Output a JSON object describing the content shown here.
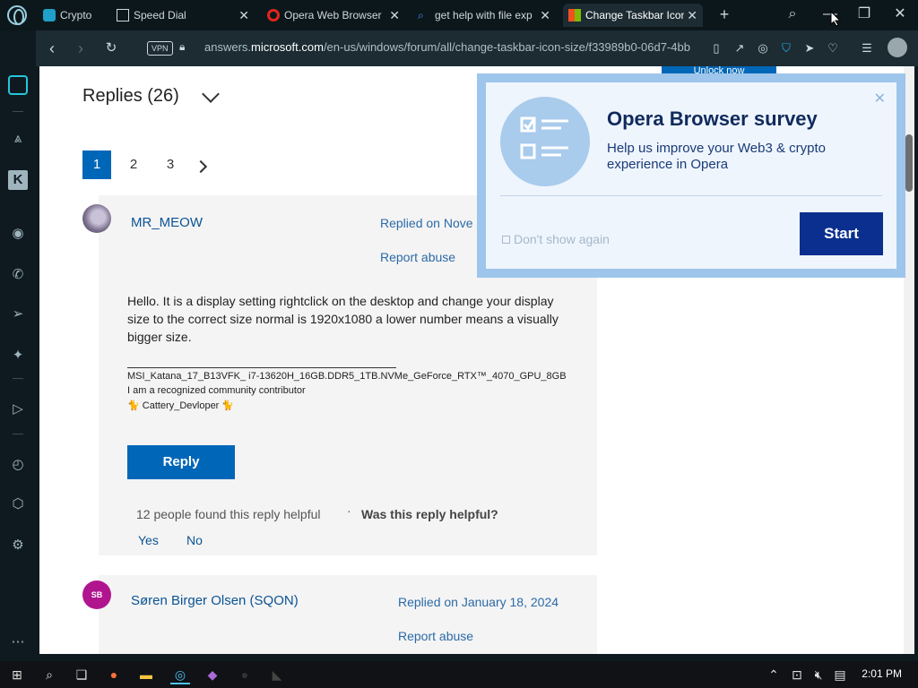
{
  "tabs": [
    {
      "label": "Crypto",
      "icon": "crypto-icon",
      "close": "✕"
    },
    {
      "label": "Speed Dial",
      "icon": "speed-dial-icon",
      "close": "✕"
    },
    {
      "label": "Opera Web Browser",
      "icon": "opera-icon",
      "close": "✕"
    },
    {
      "label": "get help with file exp",
      "icon": "search-icon",
      "close": "✕"
    },
    {
      "label": "Change Taskbar Icon",
      "icon": "microsoft-icon",
      "close": "✕"
    }
  ],
  "new_tab": "+",
  "address": {
    "vpn": "VPN",
    "url_prefix": "answers.",
    "url_domain": "microsoft.com",
    "url_path": "/en-us/windows/forum/all/change-taskbar-icon-size/f33989b0-06d7-4bb"
  },
  "page": {
    "replies_title": "Replies (26)",
    "pages": [
      "1",
      "2",
      "3"
    ],
    "unlock_label": "Unlock now"
  },
  "reply1": {
    "author": "MR_MEOW",
    "replied": "Replied on Nove",
    "report": "Report abuse",
    "body": "Hello. It is a display setting rightclick on the desktop and change your display size to the correct size normal is 1920x1080 a lower number means a visually bigger size.",
    "sig1": "MSI_Katana_17_B13VFK_ i7-13620H_16GB.DDR5_1TB.NVMe_GeForce_RTX™_4070_GPU_8GB",
    "sig2": "I am a recognized community contributor",
    "sig3": "🐈 Cattery_Devloper 🐈",
    "reply_button": "Reply",
    "helpful_count": "12 people found this reply helpful",
    "helpful_sep": "·",
    "helpful_question": "Was this reply helpful?",
    "yes": "Yes",
    "no": "No"
  },
  "reply2": {
    "initials": "SB",
    "author": "Søren Birger Olsen (SQON)",
    "replied": "Replied on January 18, 2024",
    "report": "Report abuse"
  },
  "survey": {
    "title": "Opera Browser survey",
    "desc": "Help us improve your Web3 & crypto experience in Opera",
    "dont_show": "Don't show again",
    "start": "Start",
    "close": "✕"
  },
  "taskbar": {
    "time": "2:01 PM"
  },
  "colors": {
    "accent": "#0067b8",
    "survey_button": "#0b2f8f",
    "link": "#2b6aa8"
  }
}
